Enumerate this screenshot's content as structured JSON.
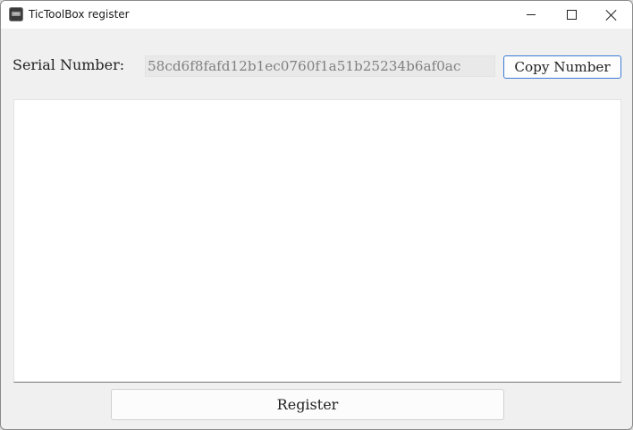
{
  "window": {
    "title": "TicToolBox register",
    "icon": "tictoolbox-app-icon"
  },
  "serial": {
    "label": "Serial Number:",
    "value": "58cd6f8fafd12b1ec0760f1a51b25234b6af0ac",
    "copy_label": "Copy Number"
  },
  "license_input": {
    "value": ""
  },
  "actions": {
    "register_label": "Register"
  },
  "colors": {
    "window_bg": "#f0f0f0",
    "titlebar_bg": "#ffffff",
    "accent_border": "#3a7bd5",
    "serial_text": "#808080"
  }
}
